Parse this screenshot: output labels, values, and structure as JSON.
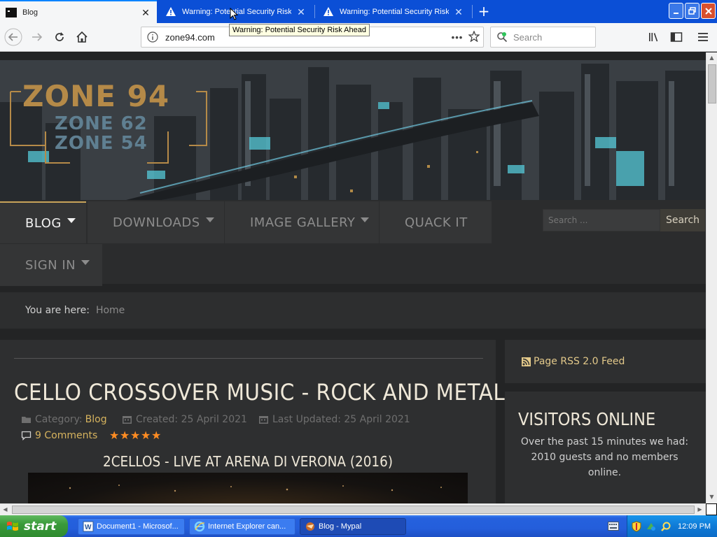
{
  "browser": {
    "tabs": [
      {
        "title": "Blog",
        "active": true
      },
      {
        "title": "Warning: Potential Security Risk A",
        "active": false
      },
      {
        "title": "Warning: Potential Security Risk A",
        "active": false
      }
    ],
    "url": "zone94.com",
    "search_placeholder": "Search",
    "tooltip": "Warning: Potential Security Risk Ahead"
  },
  "site": {
    "logo": {
      "main": "ZONE 94",
      "sub1": "ZONE 62",
      "sub2": "ZONE 54"
    },
    "nav": [
      {
        "label": "BLOG",
        "dropdown": true
      },
      {
        "label": "DOWNLOADS",
        "dropdown": true
      },
      {
        "label": "IMAGE GALLERY",
        "dropdown": true
      },
      {
        "label": "QUACK IT",
        "dropdown": false
      },
      {
        "label": "SIGN IN",
        "dropdown": true
      }
    ],
    "search": {
      "placeholder": "Search ...",
      "button": "Search"
    },
    "breadcrumb": {
      "label": "You are here:",
      "home": "Home"
    },
    "article": {
      "title": "CELLO CROSSOVER MUSIC - ROCK AND METAL",
      "category_label": "Category:",
      "category": "Blog",
      "created": "Created: 25 April 2021",
      "updated": "Last Updated: 25 April 2021",
      "comments": "9 Comments",
      "rating_stars": 5,
      "video_title": "2CELLOS - LIVE AT ARENA DI VERONA (2016)"
    },
    "sidebar": {
      "rss": "Page RSS 2.0 Feed",
      "visitors_title": "VISITORS ONLINE",
      "visitors_text": "Over the past 15 minutes we had: 2010 guests and no members online."
    }
  },
  "taskbar": {
    "start": "start",
    "tasks": [
      {
        "label": "Document1 - Microsof..."
      },
      {
        "label": "Internet Explorer can..."
      },
      {
        "label": "Blog - Mypal"
      }
    ],
    "clock": "12:09 PM"
  },
  "colors": {
    "accent_gold": "#d6b35e",
    "star_orange": "#ff8c22",
    "tab_blue": "#0b4fd6"
  }
}
